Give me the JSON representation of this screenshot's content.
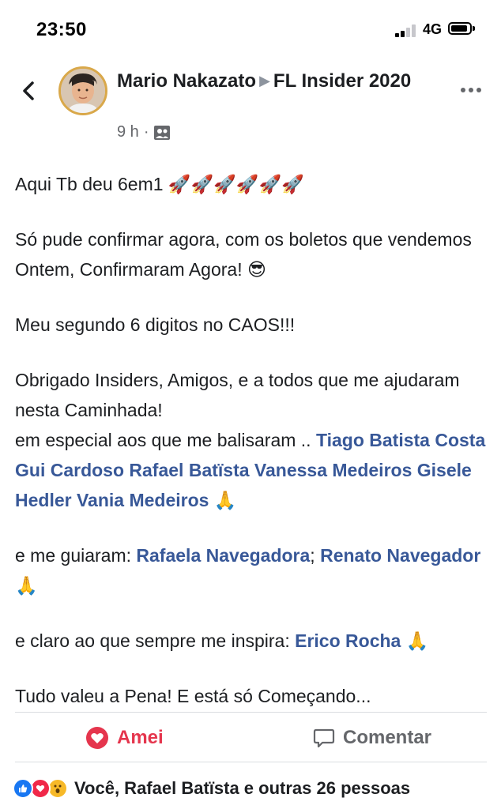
{
  "status_bar": {
    "time": "23:50",
    "network": "4G"
  },
  "post": {
    "author": "Mario Nakazato",
    "group": "FL Insider 2020",
    "time": "9 h",
    "separator": "·",
    "paragraphs": {
      "p1": "Aqui Tb deu 6em1 🚀🚀🚀🚀🚀🚀",
      "p2": "Só pude confirmar agora, com os boletos que vendemos Ontem, Confirmaram Agora! 😎",
      "p3": "Meu segundo 6 digitos no CAOS!!!",
      "p4_line1": "Obrigado Insiders, Amigos, e a todos que me ajudaram nesta Caminhada!",
      "p4_line2_prefix": "em especial aos que me balisaram .. ",
      "p4_tags": [
        "Tiago Batista Costa",
        "Gui Cardoso",
        "Rafael Batïsta",
        "Vanessa Medeiros",
        "Gisele Hedler",
        "Vania Medeiros"
      ],
      "p4_suffix": " 🙏",
      "p5_prefix": "e me guiaram: ",
      "p5_tag1": "Rafaela Navegadora",
      "p5_mid": "; ",
      "p5_tag2": "Renato Navegador",
      "p5_suffix": "🙏",
      "p6_prefix": "e claro ao que sempre me inspira: ",
      "p6_tag": "Erico Rocha",
      "p6_suffix": " 🙏",
      "p7": "Tudo valeu a Pena! E está só Começando..."
    }
  },
  "actions": {
    "react_label": "Amei",
    "comment_label": "Comentar"
  },
  "reactions": {
    "summary": "Você, Rafael Batïsta e outras 26 pessoas"
  },
  "colors": {
    "tag": "#385898",
    "love": "#e5354d",
    "muted": "#65676b"
  },
  "icons": {
    "back": "chevron-left-icon",
    "more": "more-dots-icon",
    "audience": "group-audience-icon",
    "react": "heart-icon",
    "comment": "comment-bubble-icon",
    "reaction_like": "like-icon",
    "reaction_love": "love-icon",
    "reaction_wow": "wow-icon"
  }
}
